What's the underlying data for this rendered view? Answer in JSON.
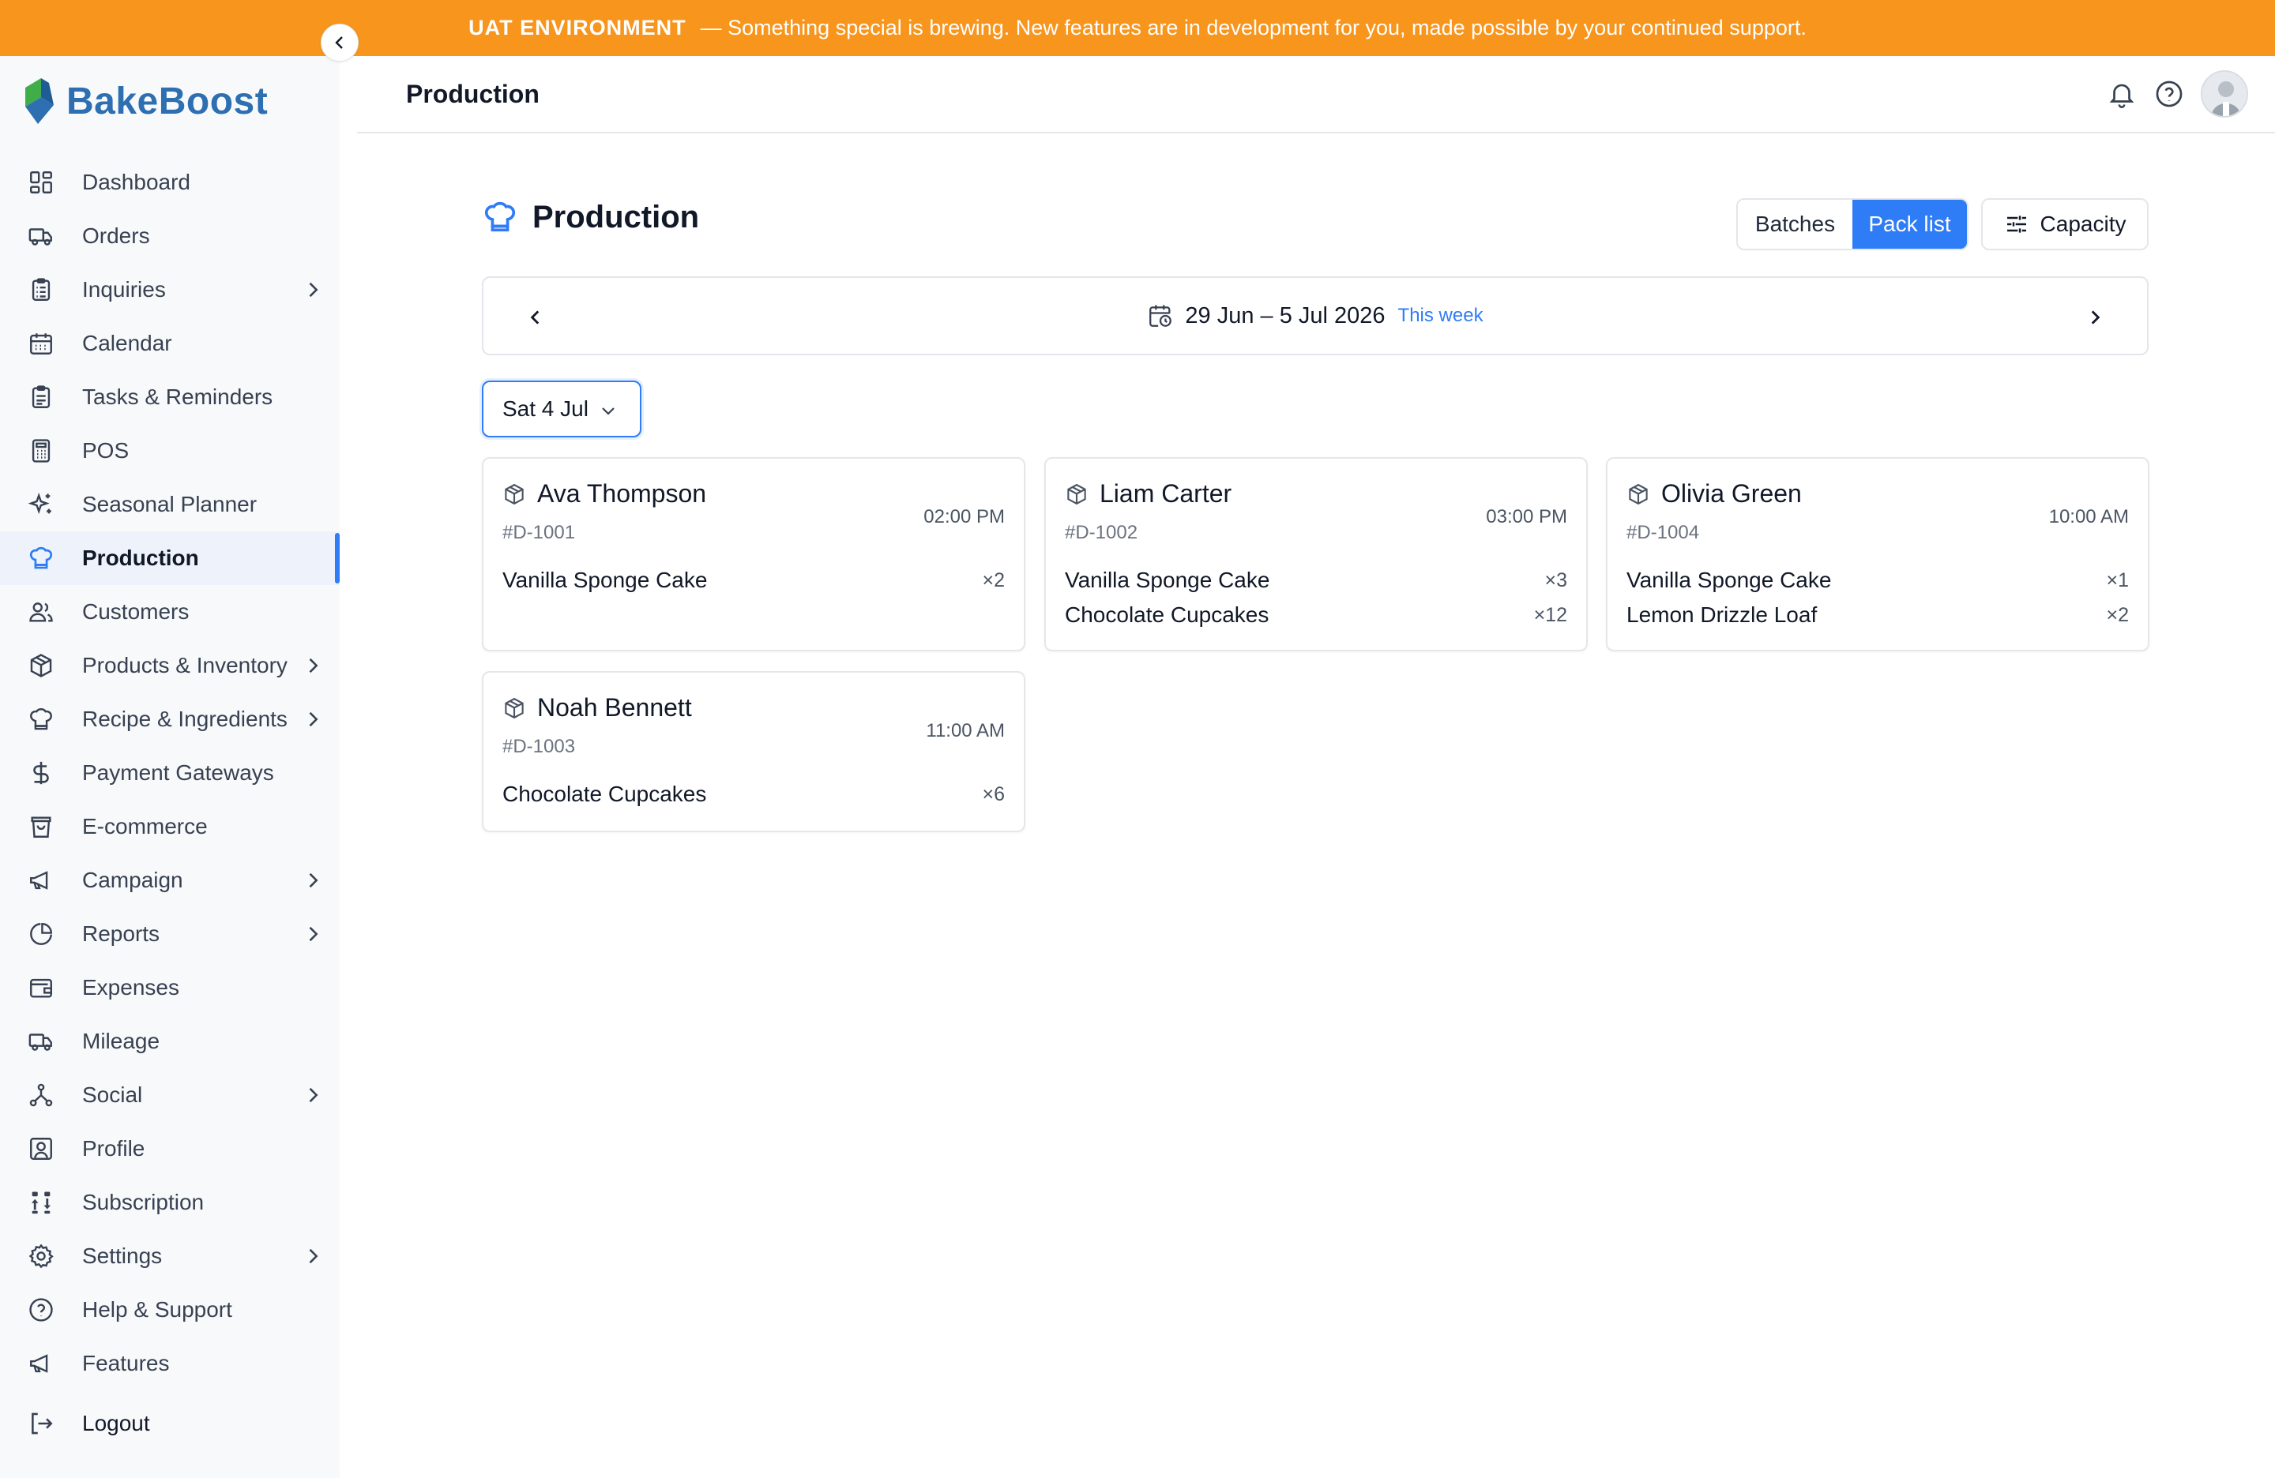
{
  "banner": {
    "env": "UAT ENVIRONMENT",
    "message": "— Something special is brewing. New features are in development for you, made possible by your continued support."
  },
  "brand": {
    "name": "BakeBoost",
    "color": "#2d6fb1",
    "accent": "#2e7cf6",
    "banner_color": "#f7951d"
  },
  "sidebar": {
    "items": [
      {
        "label": "Dashboard",
        "icon": "dashboard-icon",
        "submenu": false
      },
      {
        "label": "Orders",
        "icon": "truck-icon",
        "submenu": false
      },
      {
        "label": "Inquiries",
        "icon": "clipboard-list-icon",
        "submenu": true
      },
      {
        "label": "Calendar",
        "icon": "calendar-icon",
        "submenu": false
      },
      {
        "label": "Tasks & Reminders",
        "icon": "clipboard-check-icon",
        "submenu": false
      },
      {
        "label": "POS",
        "icon": "calculator-icon",
        "submenu": false
      },
      {
        "label": "Seasonal Planner",
        "icon": "sparkles-icon",
        "submenu": false
      },
      {
        "label": "Production",
        "icon": "chef-hat-icon",
        "submenu": false,
        "active": true
      },
      {
        "label": "Customers",
        "icon": "users-icon",
        "submenu": false
      },
      {
        "label": "Products & Inventory",
        "icon": "box-icon",
        "submenu": true
      },
      {
        "label": "Recipe & Ingredients",
        "icon": "chef-hat-icon",
        "submenu": true
      },
      {
        "label": "Payment Gateways",
        "icon": "dollar-icon",
        "submenu": false
      },
      {
        "label": "E-commerce",
        "icon": "shopping-bag-icon",
        "submenu": false
      },
      {
        "label": "Campaign",
        "icon": "megaphone-icon",
        "submenu": true
      },
      {
        "label": "Reports",
        "icon": "pie-chart-icon",
        "submenu": true
      },
      {
        "label": "Expenses",
        "icon": "wallet-icon",
        "submenu": false
      },
      {
        "label": "Mileage",
        "icon": "truck-icon",
        "submenu": false
      },
      {
        "label": "Social",
        "icon": "share-network-icon",
        "submenu": true
      },
      {
        "label": "Profile",
        "icon": "user-square-icon",
        "submenu": false
      },
      {
        "label": "Subscription",
        "icon": "sort-icon",
        "submenu": false
      },
      {
        "label": "Settings",
        "icon": "gear-icon",
        "submenu": true
      },
      {
        "label": "Help & Support",
        "icon": "help-circle-icon",
        "submenu": false
      },
      {
        "label": "Features",
        "icon": "megaphone-icon",
        "submenu": false
      }
    ],
    "logout_label": "Logout"
  },
  "header": {
    "title": "Production"
  },
  "main": {
    "title": "Production",
    "view_tabs": [
      "Batches",
      "Pack list"
    ],
    "active_tab": "Pack list",
    "capacity_label": "Capacity",
    "week_range": "29 Jun – 5 Jul 2026",
    "this_week_label": "This week",
    "selected_day": "Sat 4 Jul",
    "orders": [
      {
        "customer": "Ava Thompson",
        "id": "#D-1001",
        "time": "02:00 PM",
        "items": [
          {
            "name": "Vanilla Sponge Cake",
            "qty": "×2"
          }
        ]
      },
      {
        "customer": "Liam Carter",
        "id": "#D-1002",
        "time": "03:00 PM",
        "items": [
          {
            "name": "Vanilla Sponge Cake",
            "qty": "×3"
          },
          {
            "name": "Chocolate Cupcakes",
            "qty": "×12"
          }
        ]
      },
      {
        "customer": "Olivia Green",
        "id": "#D-1004",
        "time": "10:00 AM",
        "items": [
          {
            "name": "Vanilla Sponge Cake",
            "qty": "×1"
          },
          {
            "name": "Lemon Drizzle Loaf",
            "qty": "×2"
          }
        ]
      },
      {
        "customer": "Noah Bennett",
        "id": "#D-1003",
        "time": "11:00 AM",
        "items": [
          {
            "name": "Chocolate Cupcakes",
            "qty": "×6"
          }
        ]
      }
    ]
  }
}
